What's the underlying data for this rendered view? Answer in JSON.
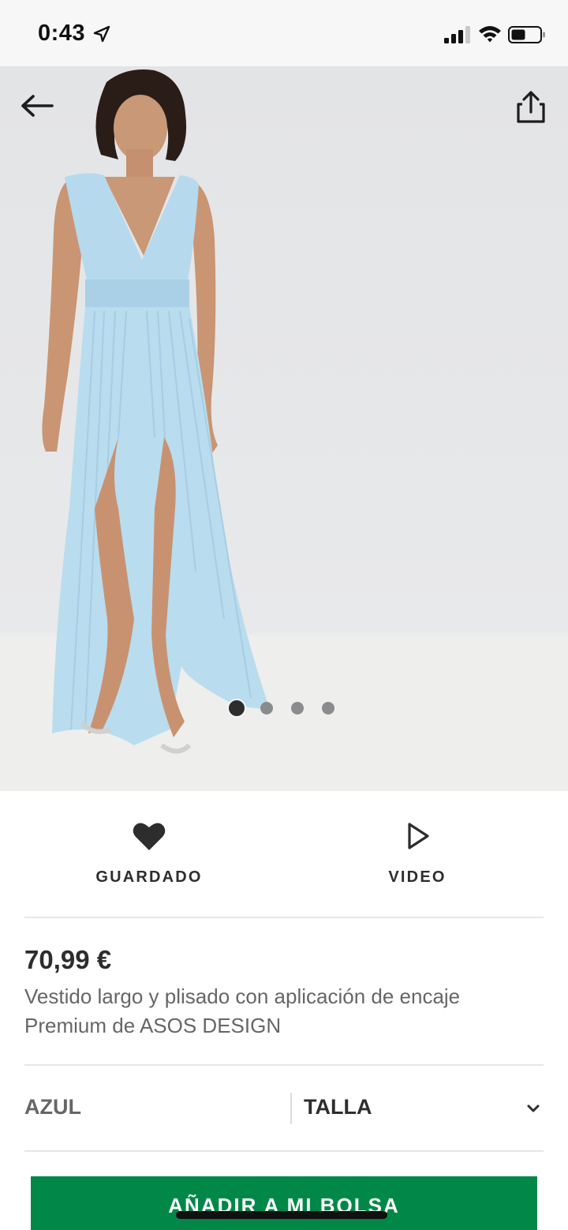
{
  "status_bar": {
    "time": "0:43"
  },
  "product": {
    "image_count": 4,
    "active_image": 1,
    "price": "70,99 €",
    "title": "Vestido largo y plisado con aplicación de encaje Premium de ASOS DESIGN"
  },
  "actions": {
    "save_label": "GUARDADO",
    "video_label": "VIDEO"
  },
  "options": {
    "color": "AZUL",
    "size_label": "TALLA"
  },
  "cart": {
    "add_label": "AÑADIR A MI BOLSA"
  },
  "icons": {
    "back": "arrow-left-icon",
    "share": "share-icon",
    "save": "heart-icon",
    "video": "play-icon",
    "size_dropdown": "chevron-down-icon"
  },
  "colors": {
    "accent_green": "#018849",
    "text_dark": "#2d2d2d",
    "text_muted": "#666666",
    "dress_blue": "#b9dcef"
  }
}
